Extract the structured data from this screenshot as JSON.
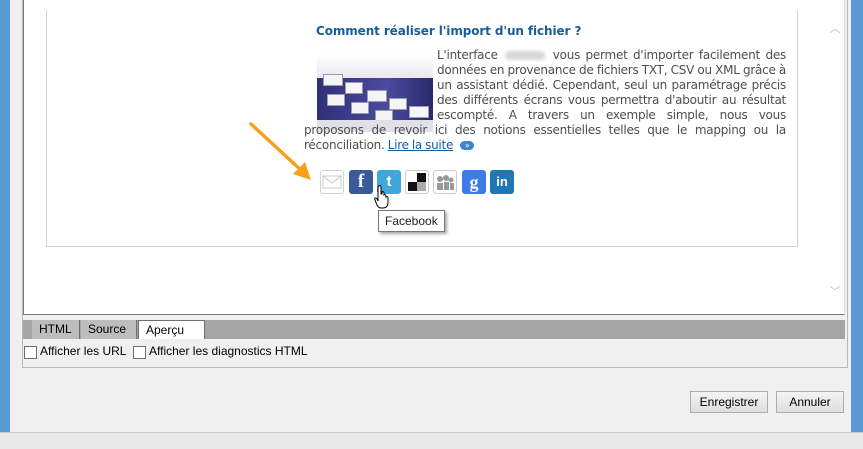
{
  "article": {
    "title": "Comment réaliser l'import d'un fichier ?",
    "text_before_blur": "L'interface",
    "text_after_blur": "vous permet d'importer facilement des données en provenance de fichiers TXT, CSV ou XML grâce à un assistant dédié. Cependant, seul un paramétrage précis des différents écrans vous permettra d'aboutir au résultat escompté. A travers un exemple simple, nous vous proposons de revoir ici des notions essentielles telles que le mapping ou la réconciliation.",
    "read_more": "Lire la suite",
    "read_more_chevron": "»"
  },
  "share_icons": [
    {
      "name": "mail-icon",
      "glyph": "✉"
    },
    {
      "name": "facebook-icon",
      "glyph": "f"
    },
    {
      "name": "twitter-icon",
      "glyph": "t"
    },
    {
      "name": "delicious-icon",
      "glyph": ""
    },
    {
      "name": "myspace-icon",
      "glyph": "㊊"
    },
    {
      "name": "google-icon",
      "glyph": "g"
    },
    {
      "name": "linkedin-icon",
      "glyph": "in"
    }
  ],
  "tooltip": "Facebook",
  "tabs": {
    "html": "HTML",
    "source": "Source",
    "apercu": "Aperçu",
    "active": "Aperçu"
  },
  "options": {
    "show_urls": "Afficher les URL",
    "show_diagnostics": "Afficher les diagnostics HTML"
  },
  "buttons": {
    "save": "Enregistrer",
    "cancel": "Annuler"
  },
  "colors": {
    "accent_link": "#1b5e97",
    "annotation_arrow": "#f5a11c",
    "facebook": "#3b5a99",
    "twitter": "#3fa7dc",
    "linkedin": "#1f78b4",
    "google": "#3d7be8"
  }
}
